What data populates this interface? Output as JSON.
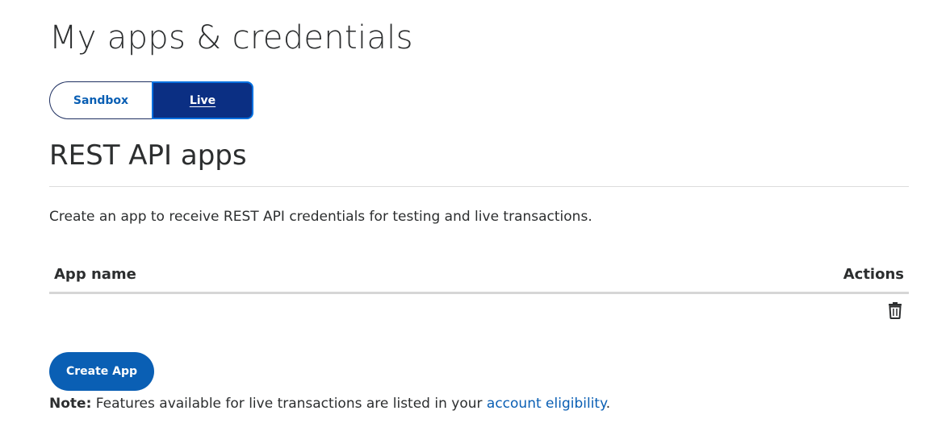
{
  "page": {
    "title": "My apps & credentials"
  },
  "environment_toggle": {
    "options": [
      {
        "label": "Sandbox",
        "selected": false
      },
      {
        "label": "Live",
        "selected": true
      }
    ]
  },
  "rest_api": {
    "title": "REST API apps",
    "description": "Create an app to receive REST API credentials for testing and live transactions.",
    "table": {
      "columns": [
        "App name",
        "Actions"
      ],
      "rows": [
        {
          "app_name": "",
          "actions": [
            "trash-icon"
          ]
        }
      ]
    },
    "create_button_label": "Create App"
  },
  "note": {
    "label": "Note:",
    "text": " Features available for live transactions are listed in your ",
    "link_text": "account eligibility",
    "suffix": "."
  },
  "colors": {
    "primary_blue": "#0a5fb4",
    "live_selected_bg": "#0b2f83",
    "text": "#2c2e2f"
  }
}
